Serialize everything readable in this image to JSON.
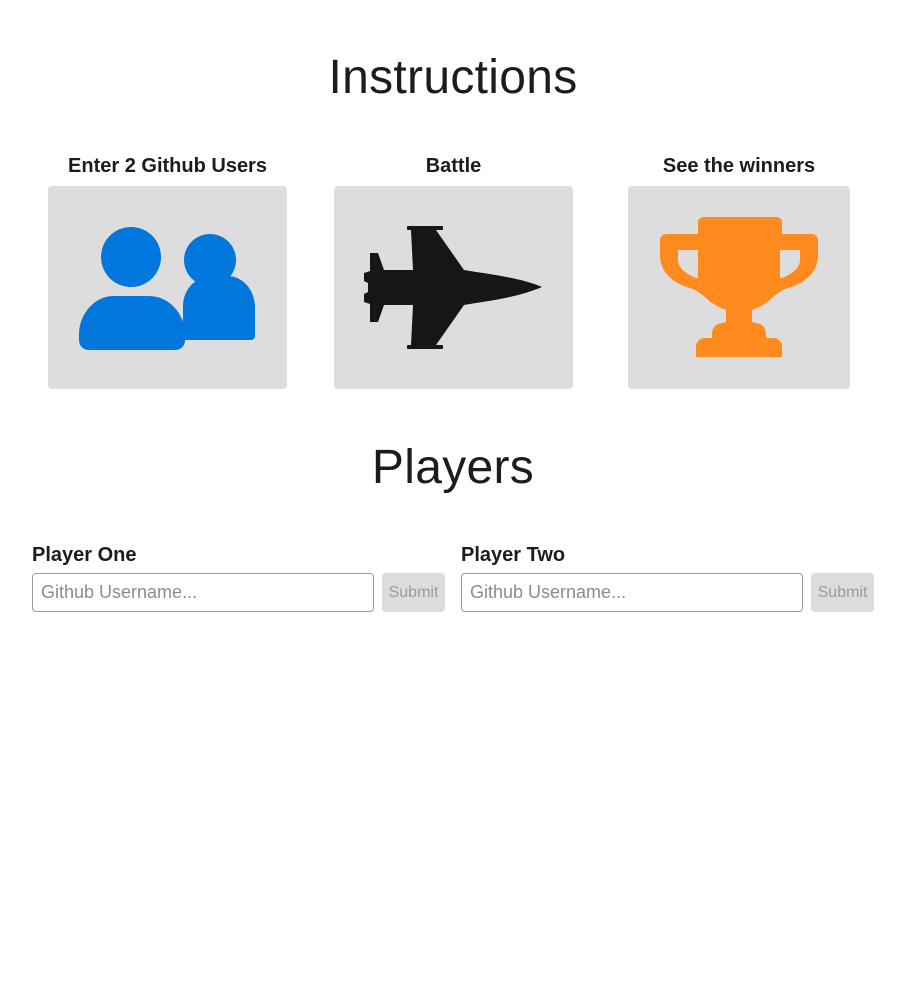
{
  "instructions": {
    "title": "Instructions",
    "steps": [
      {
        "label": "Enter 2 Github Users",
        "icon": "users-icon",
        "color": "#0077dd"
      },
      {
        "label": "Battle",
        "icon": "fighter-jet-icon",
        "color": "#161616"
      },
      {
        "label": "See the winners",
        "icon": "trophy-icon",
        "color": "#ff8a1e"
      }
    ]
  },
  "players": {
    "title": "Players",
    "player_one": {
      "label": "Player One",
      "placeholder": "Github Username...",
      "value": "",
      "submit_label": "Submit"
    },
    "player_two": {
      "label": "Player Two",
      "placeholder": "Github Username...",
      "value": "",
      "submit_label": "Submit"
    }
  }
}
